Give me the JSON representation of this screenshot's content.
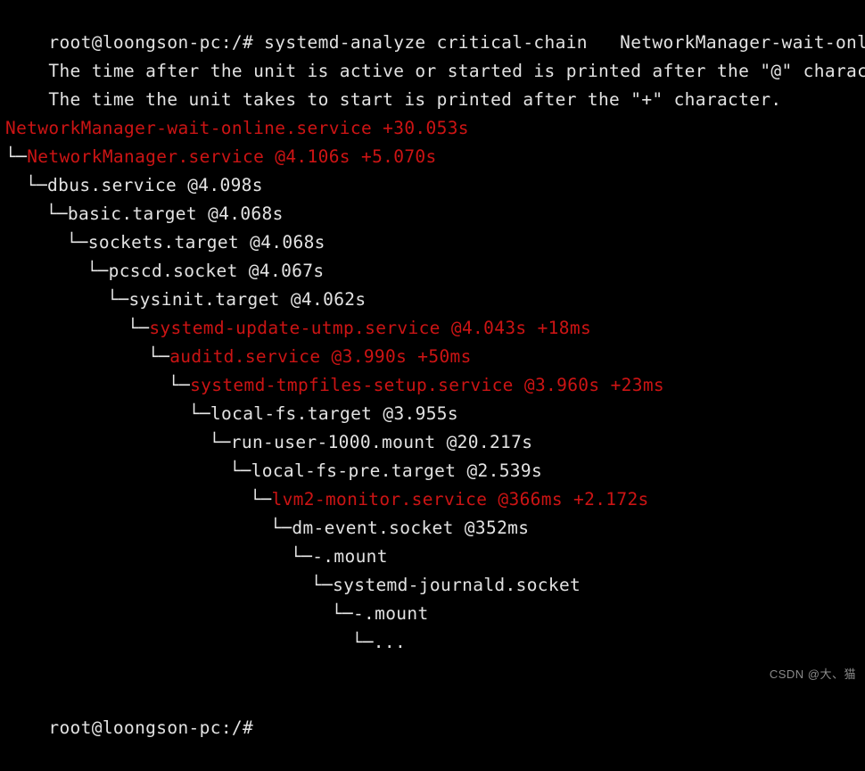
{
  "terminal": {
    "background_color": "#000000",
    "foreground_color": "#e2e2e2",
    "highlight_color": "#cc1414",
    "watermark_color": "#8a8a8a",
    "watermark": "CSDN @大、猫",
    "prompt_command": "root@loongson-pc:/# systemd-analyze critical-chain   NetworkManager-wait-online.service",
    "legend_line_1": "The time after the unit is active or started is printed after the \"@\" character.",
    "legend_line_2": "The time the unit takes to start is printed after the \"+\" character.",
    "blank_line": "",
    "final_prompt": "root@loongson-pc:/#",
    "tree": [
      {
        "indent": 0,
        "branch": "",
        "text": "NetworkManager-wait-online.service +30.053s",
        "color": "red"
      },
      {
        "indent": 0,
        "branch": "└─",
        "text": "NetworkManager.service @4.106s +5.070s",
        "color": "red"
      },
      {
        "indent": 1,
        "branch": "└─",
        "text": "dbus.service @4.098s",
        "color": "white"
      },
      {
        "indent": 2,
        "branch": "└─",
        "text": "basic.target @4.068s",
        "color": "white"
      },
      {
        "indent": 3,
        "branch": "└─",
        "text": "sockets.target @4.068s",
        "color": "white"
      },
      {
        "indent": 4,
        "branch": "└─",
        "text": "pcscd.socket @4.067s",
        "color": "white"
      },
      {
        "indent": 5,
        "branch": "└─",
        "text": "sysinit.target @4.062s",
        "color": "white"
      },
      {
        "indent": 6,
        "branch": "└─",
        "text": "systemd-update-utmp.service @4.043s +18ms",
        "color": "red"
      },
      {
        "indent": 7,
        "branch": "└─",
        "text": "auditd.service @3.990s +50ms",
        "color": "red"
      },
      {
        "indent": 8,
        "branch": "└─",
        "text": "systemd-tmpfiles-setup.service @3.960s +23ms",
        "color": "red"
      },
      {
        "indent": 9,
        "branch": "└─",
        "text": "local-fs.target @3.955s",
        "color": "white"
      },
      {
        "indent": 10,
        "branch": "└─",
        "text": "run-user-1000.mount @20.217s",
        "color": "white"
      },
      {
        "indent": 11,
        "branch": "└─",
        "text": "local-fs-pre.target @2.539s",
        "color": "white"
      },
      {
        "indent": 12,
        "branch": "└─",
        "text": "lvm2-monitor.service @366ms +2.172s",
        "color": "red"
      },
      {
        "indent": 13,
        "branch": "└─",
        "text": "dm-event.socket @352ms",
        "color": "white"
      },
      {
        "indent": 14,
        "branch": "└─",
        "text": "-.mount",
        "color": "white"
      },
      {
        "indent": 15,
        "branch": "└─",
        "text": "systemd-journald.socket",
        "color": "white"
      },
      {
        "indent": 16,
        "branch": "└─",
        "text": "-.mount",
        "color": "white"
      },
      {
        "indent": 17,
        "branch": "└─",
        "text": "...",
        "color": "white"
      }
    ]
  }
}
